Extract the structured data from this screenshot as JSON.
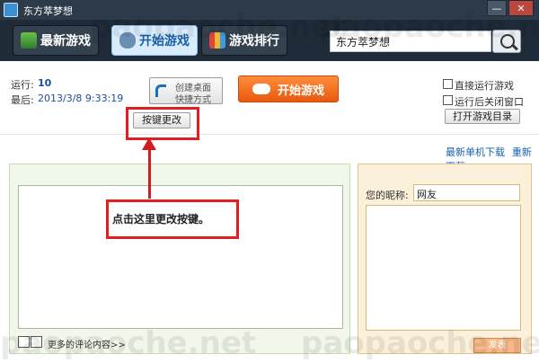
{
  "window": {
    "title": "东方萃梦想",
    "minimize": "—",
    "close": "✕"
  },
  "nav": {
    "tabs": [
      {
        "label": "最新游戏",
        "active": false,
        "icon": "gift-box-icon"
      },
      {
        "label": "开始游戏",
        "active": true,
        "icon": "gamepad-icon"
      },
      {
        "label": "游戏排行",
        "active": false,
        "icon": "bar-chart-icon"
      }
    ]
  },
  "search": {
    "value": "东方萃梦想",
    "icon": "search-icon"
  },
  "info": {
    "run_label": "运行:",
    "run_count": "10",
    "last_label": "最后:",
    "last_time": "2013/3/8 9:33:19"
  },
  "toolbar": {
    "shortcut_line1": "创建桌面",
    "shortcut_line2": "快捷方式",
    "start_label": "开始游戏",
    "keymap_label": "按键更改",
    "direct_run_label": "直接运行游戏",
    "close_after_run_label": "运行后关闭窗口",
    "open_dir_label": "打开游戏目录"
  },
  "links": {
    "latest_download": "最新单机下载",
    "redownload": "重新下载"
  },
  "annotation": {
    "text": "点击这里更改按键。"
  },
  "comments": {
    "more": "更多的评论内容>>"
  },
  "nickname": {
    "label": "您的昵称:",
    "value": "网友"
  },
  "submit": {
    "label": "发表"
  },
  "watermark": {
    "text": "paopaoche.net"
  },
  "colors": {
    "accent_orange": "#f06a1c",
    "highlight_red": "#e02020",
    "link_blue": "#1a5fa8"
  }
}
